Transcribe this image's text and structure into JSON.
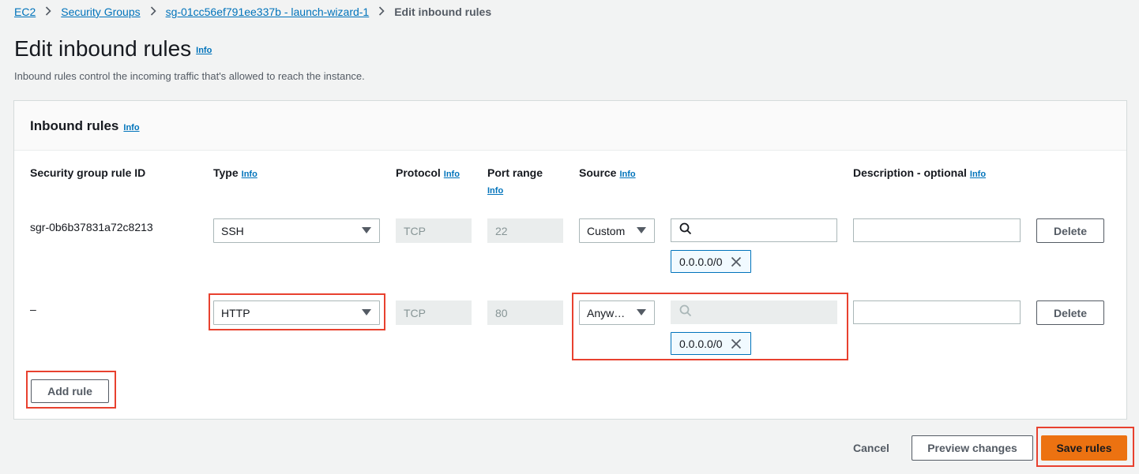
{
  "breadcrumb": {
    "items": [
      "EC2",
      "Security Groups",
      "sg-01cc56ef791ee337b - launch-wizard-1"
    ],
    "current": "Edit inbound rules"
  },
  "page": {
    "title": "Edit inbound rules",
    "info": "Info",
    "description": "Inbound rules control the incoming traffic that's allowed to reach the instance."
  },
  "panel": {
    "title": "Inbound rules",
    "info": "Info"
  },
  "columns": {
    "rule_id": "Security group rule ID",
    "type": "Type",
    "protocol": "Protocol",
    "port_range": "Port range",
    "source": "Source",
    "description": "Description - optional",
    "info": "Info"
  },
  "rules": [
    {
      "rule_id": "sgr-0b6b37831a72c8213",
      "type": "SSH",
      "protocol": "TCP",
      "port_range": "22",
      "source": "Custom",
      "cidr_token": "0.0.0.0/0",
      "description": "",
      "delete_label": "Delete"
    },
    {
      "rule_id": "–",
      "type": "HTTP",
      "protocol": "TCP",
      "port_range": "80",
      "source": "Anyw…",
      "cidr_token": "0.0.0.0/0",
      "description": "",
      "delete_label": "Delete"
    }
  ],
  "actions": {
    "add_rule": "Add rule",
    "cancel": "Cancel",
    "preview": "Preview changes",
    "save": "Save rules"
  },
  "colors": {
    "link": "#0073bb",
    "primary": "#ec7211",
    "highlight": "#e8412f"
  },
  "icons": {
    "breadcrumb_separator": "chevron-right-icon",
    "select_caret": "caret-down-icon",
    "search": "search-icon",
    "token_remove": "close-icon"
  }
}
